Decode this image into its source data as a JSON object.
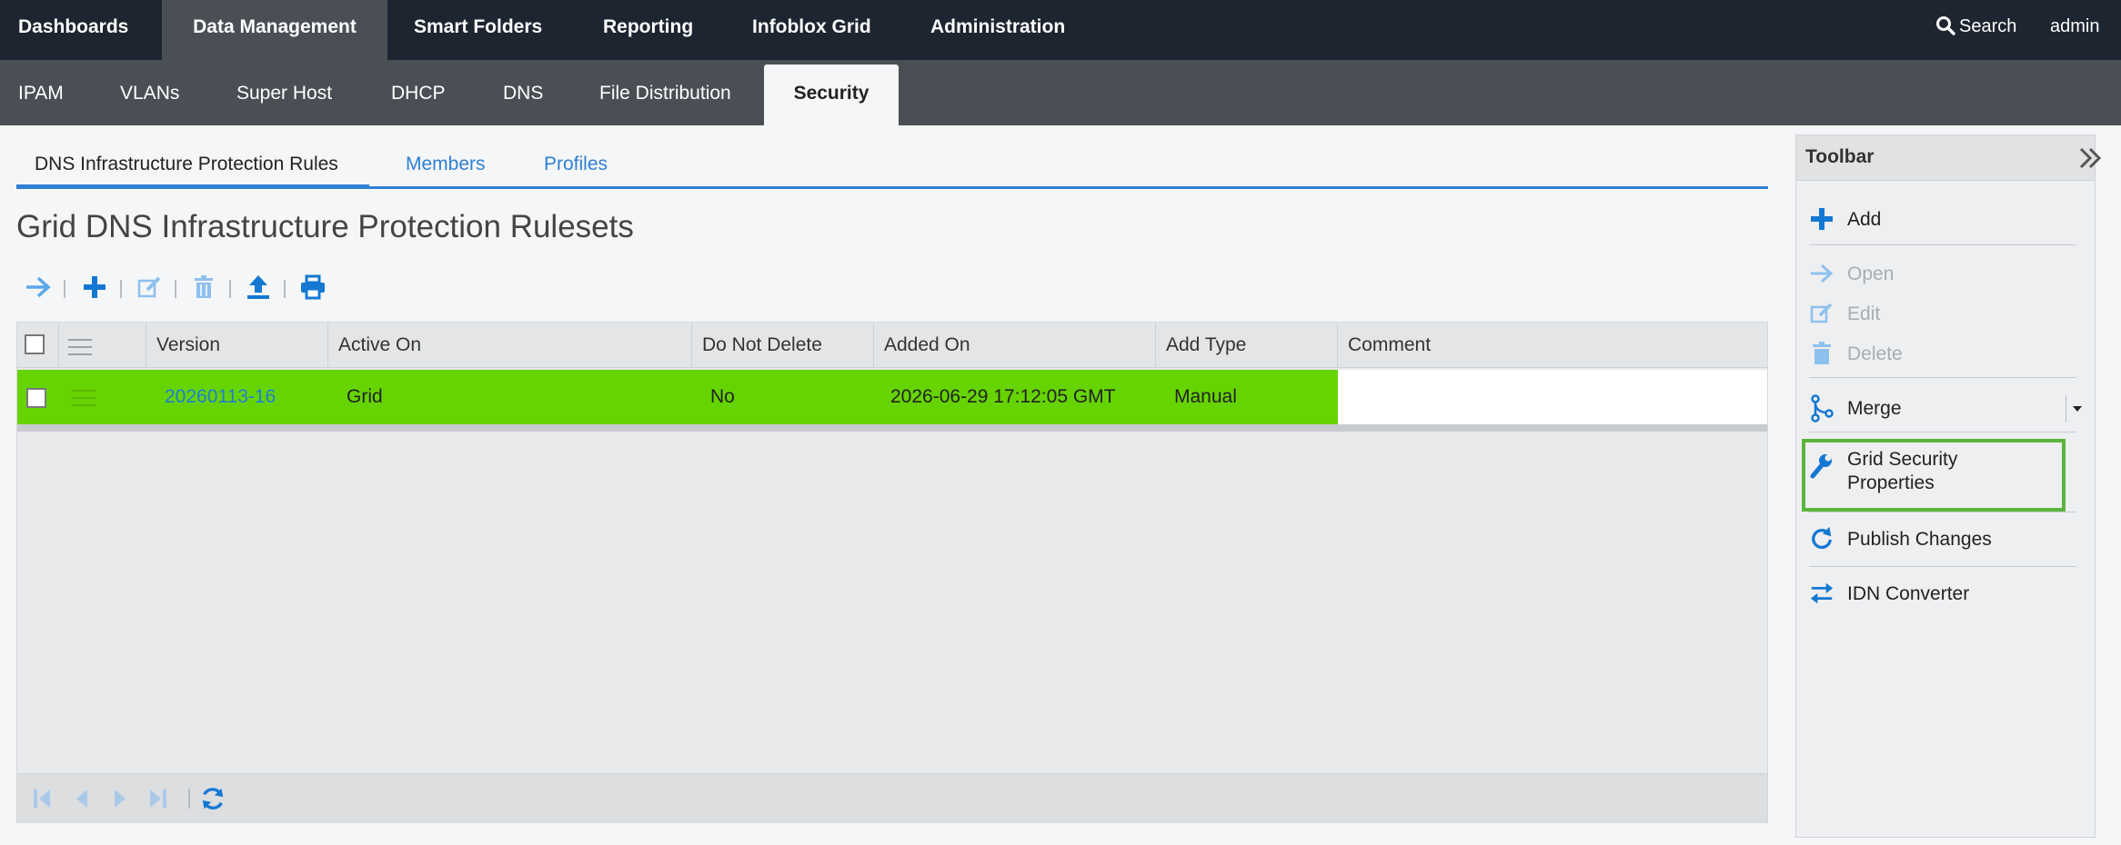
{
  "topnav": {
    "tabs": [
      {
        "label": "Dashboards"
      },
      {
        "label": "Data Management"
      },
      {
        "label": "Smart Folders"
      },
      {
        "label": "Reporting"
      },
      {
        "label": "Infoblox Grid"
      },
      {
        "label": "Administration"
      }
    ],
    "active_tab": "Data Management",
    "search_label": "Search",
    "user": "admin"
  },
  "subnav": {
    "tabs": [
      {
        "label": "IPAM"
      },
      {
        "label": "VLANs"
      },
      {
        "label": "Super Host"
      },
      {
        "label": "DHCP"
      },
      {
        "label": "DNS"
      },
      {
        "label": "File Distribution"
      },
      {
        "label": "Security"
      }
    ],
    "active_tab": "Security"
  },
  "content": {
    "tabs": [
      {
        "label": "DNS Infrastructure Protection Rules"
      },
      {
        "label": "Members"
      },
      {
        "label": "Profiles"
      }
    ],
    "active_tab": "DNS Infrastructure Protection Rules",
    "title": "Grid DNS Infrastructure Protection Rulesets",
    "action_icons": [
      "open-arrow-icon",
      "add-plus-icon",
      "edit-icon",
      "delete-trash-icon",
      "upload-export-icon",
      "print-icon"
    ]
  },
  "grid": {
    "columns": [
      "",
      "",
      "Version",
      "Active On",
      "Do Not Delete",
      "Added On",
      "Add Type",
      "Comment"
    ],
    "rows": [
      {
        "version": "20260113-16",
        "active_on": "Grid",
        "do_not_delete": "No",
        "added_on": "2026-06-29 17:12:05 GMT",
        "add_type": "Manual",
        "comment": ""
      }
    ],
    "footer_icons": [
      "first-page-icon",
      "prev-page-icon",
      "next-page-icon",
      "last-page-icon",
      "refresh-icon"
    ]
  },
  "toolbar": {
    "title": "Toolbar",
    "items": [
      {
        "label": "Add",
        "icon": "plus-icon",
        "enabled": true
      },
      {
        "label": "Open",
        "icon": "arrow-right-icon",
        "enabled": false
      },
      {
        "label": "Edit",
        "icon": "edit-icon",
        "enabled": false
      },
      {
        "label": "Delete",
        "icon": "trash-icon",
        "enabled": false
      },
      {
        "label": "Merge",
        "icon": "merge-icon",
        "enabled": true
      },
      {
        "label_line1": "Grid Security",
        "label_line2": "Properties",
        "icon": "wrench-icon",
        "enabled": true,
        "highlighted": true
      },
      {
        "label": "Publish Changes",
        "icon": "refresh-icon",
        "enabled": true
      },
      {
        "label": "IDN Converter",
        "icon": "swap-arrows-icon",
        "enabled": true
      }
    ]
  },
  "colors": {
    "topnav_bg": "#1d2530",
    "subnav_bg": "#4a4f55",
    "accent_blue": "#2f7fd3",
    "row_highlight_green": "#66d400",
    "highlight_border_green": "#5bb53c"
  }
}
